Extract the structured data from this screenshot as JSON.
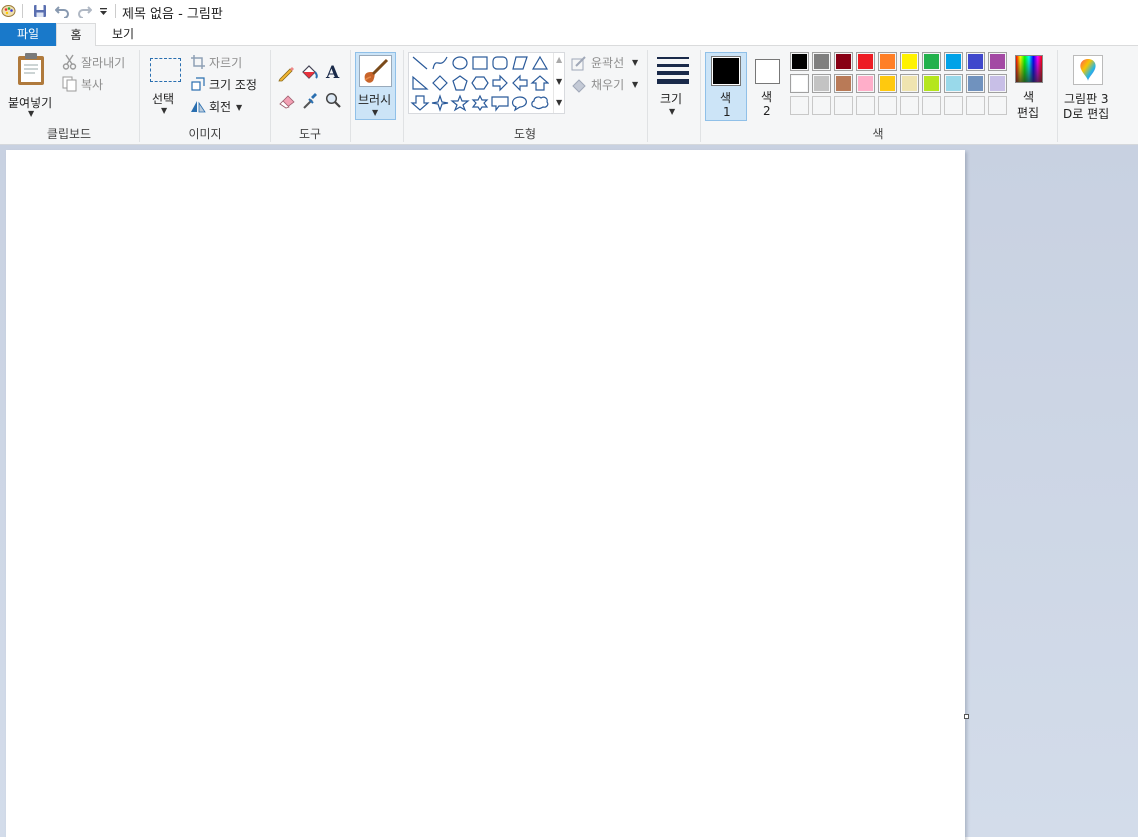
{
  "window": {
    "title": "제목 없음 - 그림판"
  },
  "tabs": [
    {
      "label": "파일",
      "active": false,
      "style": "file"
    },
    {
      "label": "홈",
      "active": true
    },
    {
      "label": "보기",
      "active": false
    }
  ],
  "ribbon": {
    "clipboard": {
      "paste": "붙여넣기",
      "cut": "잘라내기",
      "copy": "복사",
      "group": "클립보드"
    },
    "image": {
      "select": "선택",
      "crop": "자르기",
      "resize": "크기 조정",
      "rotate": "회전",
      "group": "이미지"
    },
    "tools": {
      "group": "도구",
      "text_glyph": "A"
    },
    "brushes": {
      "label": "브러시"
    },
    "shapes": {
      "outline": "윤곽선",
      "fill": "채우기",
      "group": "도형"
    },
    "size": {
      "label": "크기"
    },
    "colors": {
      "color1_line1": "색",
      "color1_line2": "1",
      "color2_line1": "색",
      "color2_line2": "2",
      "edit_line1": "색",
      "edit_line2": "편집",
      "group": "색",
      "color1_value": "#000000",
      "color2_value": "#ffffff",
      "palette_row1": [
        "#000000",
        "#7f7f7f",
        "#880015",
        "#ed1c24",
        "#ff7f27",
        "#fff200",
        "#22b14c",
        "#00a2e8",
        "#3f48cc",
        "#a349a4"
      ],
      "palette_row2": [
        "#ffffff",
        "#c3c3c3",
        "#b97a57",
        "#ffaec9",
        "#ffc90e",
        "#efe4b0",
        "#b5e61d",
        "#99d9ea",
        "#7092be",
        "#c8bfe7"
      ],
      "palette_row3": [
        "",
        "",
        "",
        "",
        "",
        "",
        "",
        "",
        "",
        ""
      ]
    },
    "paint3d": {
      "line1": "그림판 3",
      "line2": "D로 편집"
    }
  }
}
